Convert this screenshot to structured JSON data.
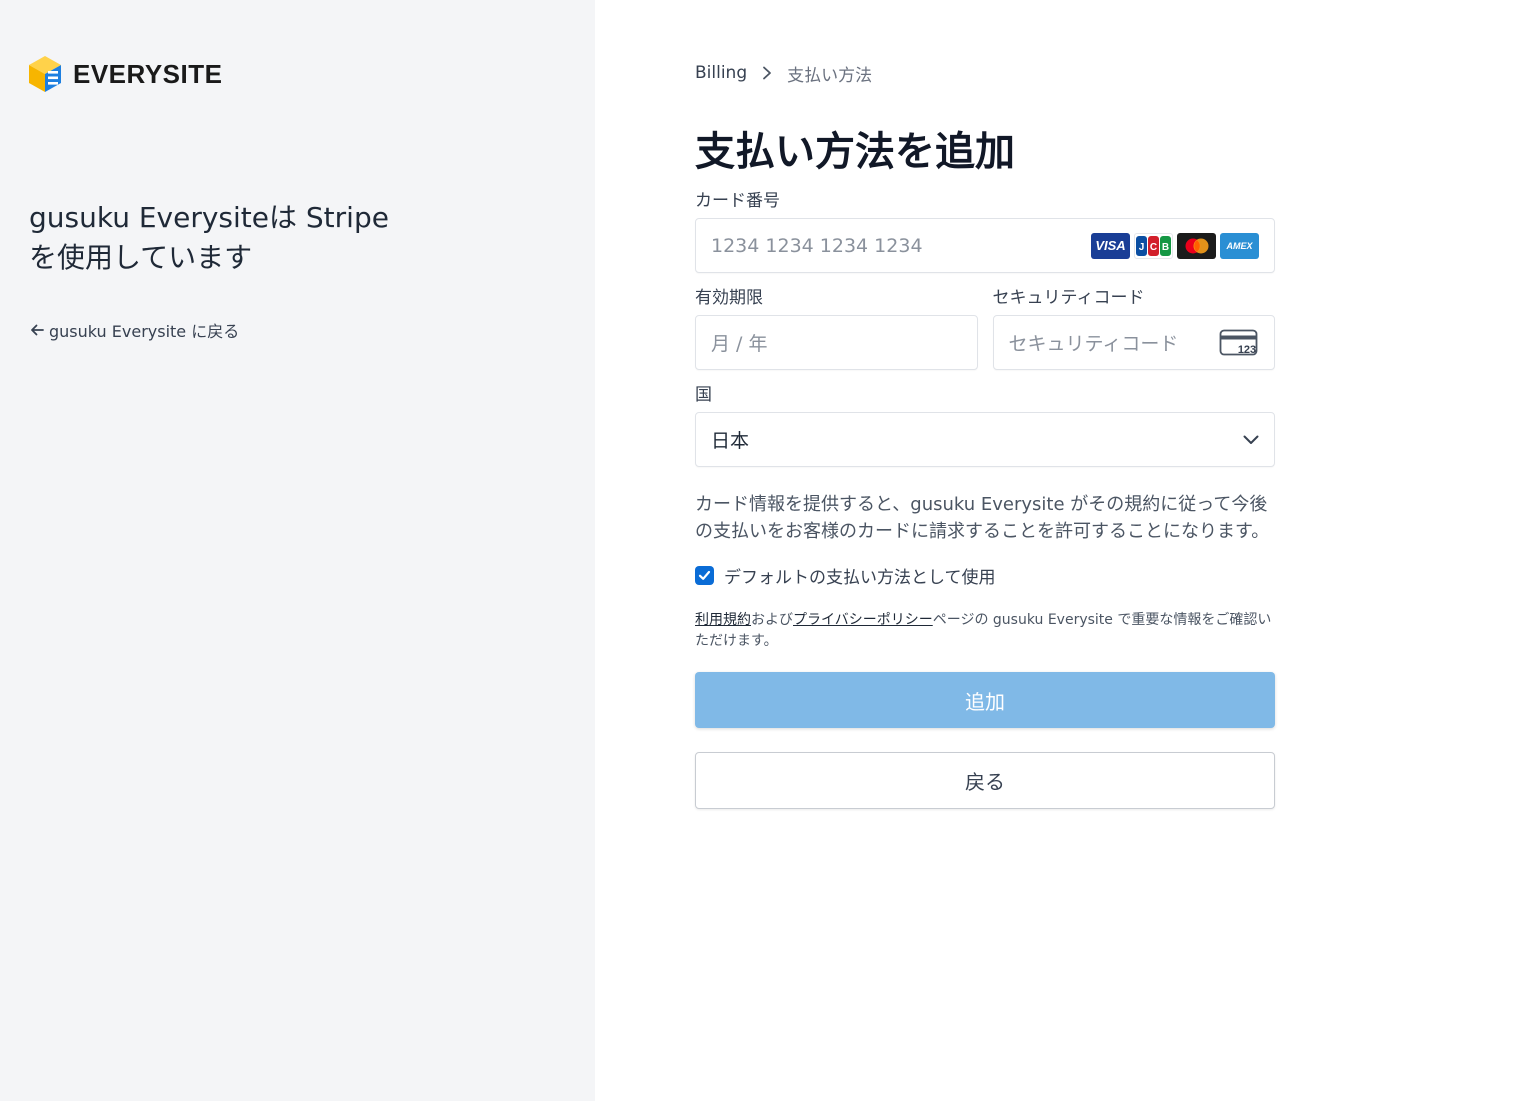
{
  "brand": {
    "name": "EVERYSITE"
  },
  "left": {
    "tagline": "gusuku Everysiteは Stripe を使用しています",
    "back_link": "gusuku Everysite に戻る"
  },
  "breadcrumb": {
    "parent": "Billing",
    "current": "支払い方法"
  },
  "page": {
    "title": "支払い方法を追加"
  },
  "form": {
    "card_number_label": "カード番号",
    "card_number_placeholder": "1234 1234 1234 1234",
    "card_brands": [
      "VISA",
      "JCB",
      "Mastercard",
      "AMEX"
    ],
    "expiry_label": "有効期限",
    "expiry_placeholder": "月 / 年",
    "cvc_label": "セキュリティコード",
    "cvc_placeholder": "セキュリティコード",
    "cvc_icon_text": "123",
    "country_label": "国",
    "country_value": "日本",
    "consent_text": "カード情報を提供すると、gusuku Everysite がその規約に従って今後の支払いをお客様のカードに請求することを許可することになります。",
    "default_checkbox_label": "デフォルトの支払い方法として使用",
    "default_checked": true,
    "terms_link": "利用規約",
    "terms_and": "および",
    "privacy_link": "プライバシーポリシー",
    "terms_rest": "ページの gusuku Everysite で重要な情報をご確認いただけます。"
  },
  "buttons": {
    "add": "追加",
    "back": "戻る"
  },
  "colors": {
    "primary_button": "#80b9e7",
    "checkbox": "#0a6cd6",
    "left_panel_bg": "#f4f5f7",
    "logo_yellow": "#f7b500",
    "logo_blue": "#1d7fe0"
  }
}
